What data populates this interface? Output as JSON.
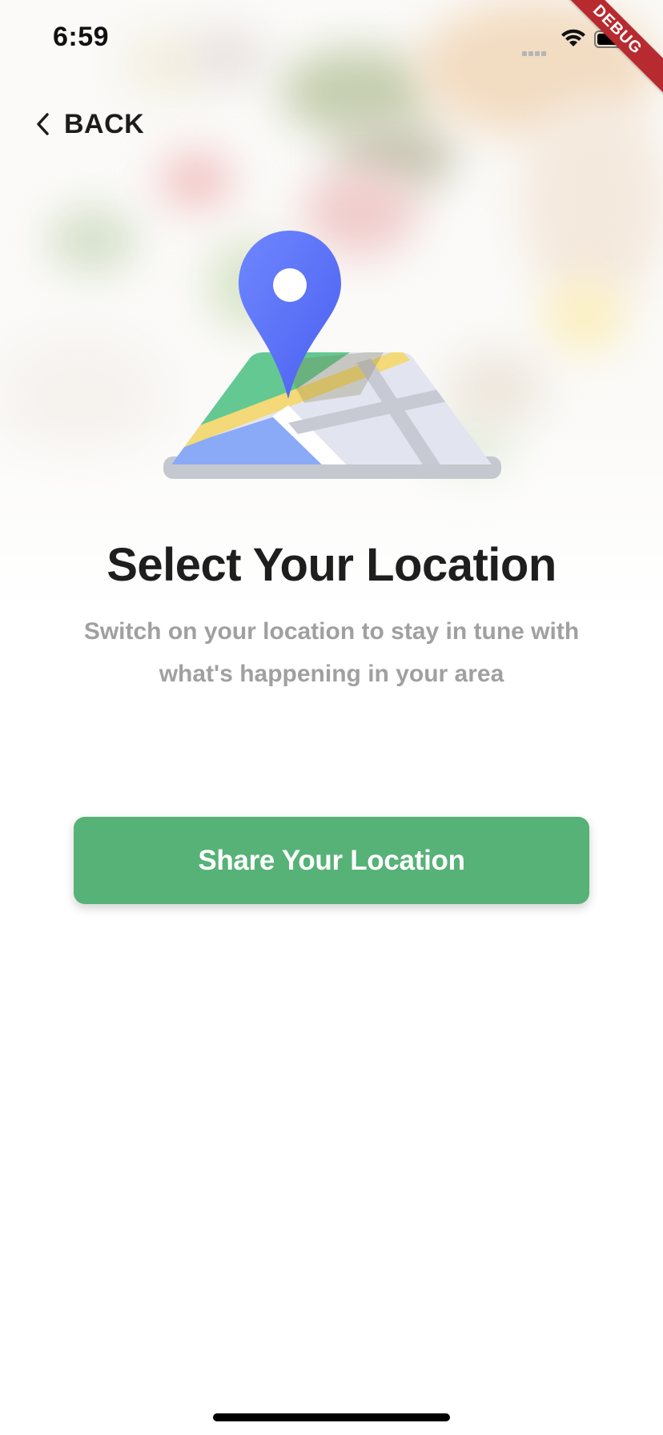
{
  "status_bar": {
    "time": "6:59",
    "icons": [
      "signal-icon",
      "wifi-icon",
      "battery-icon"
    ]
  },
  "debug_ribbon": {
    "label": "DEBUG"
  },
  "nav": {
    "back_label": "BACK",
    "back_icon": "chevron-left-icon"
  },
  "illustration": {
    "icon": "map-pin-icon"
  },
  "content": {
    "title": "Select Your Location",
    "subtitle": "Switch on your location to stay in tune with what's happening in your area"
  },
  "actions": {
    "share_label": "Share Your Location"
  },
  "colors": {
    "accent_green": "#56b277",
    "pin_blue": "#5b74f5",
    "title_text": "#1e1e1e",
    "subtitle_text": "#a0a0a0",
    "debug_red": "#b72a2f"
  }
}
